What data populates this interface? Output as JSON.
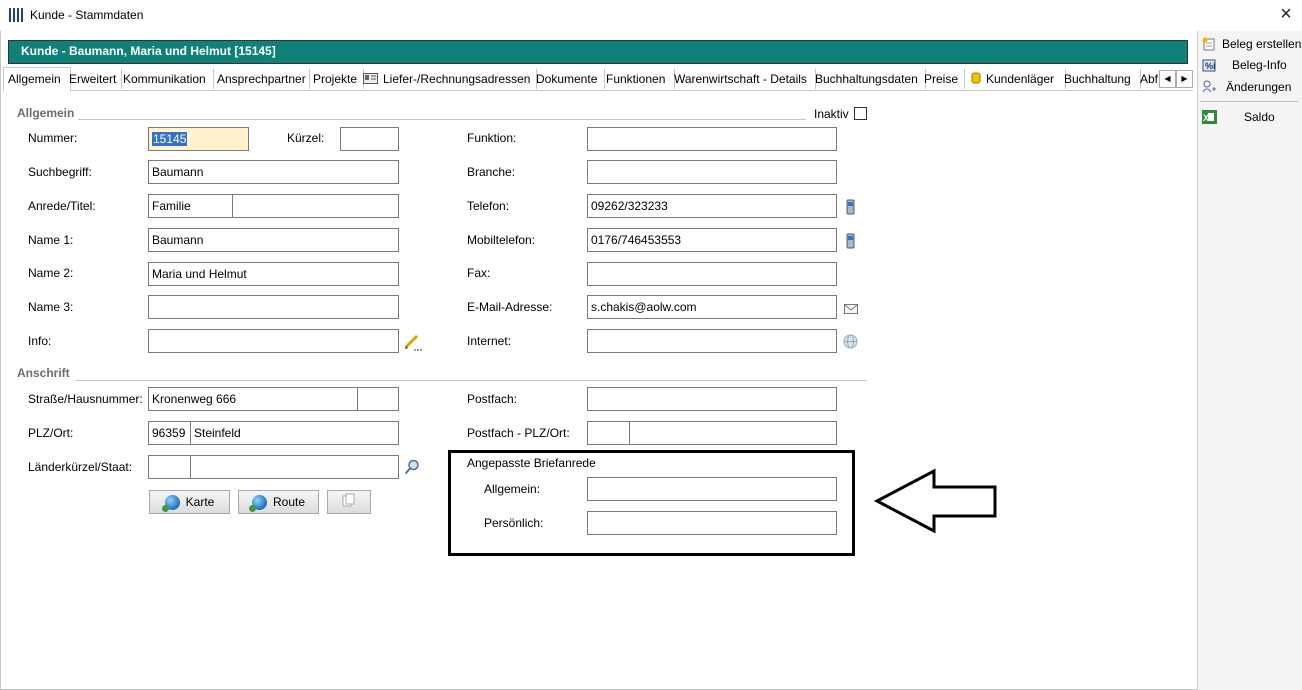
{
  "window": {
    "title": "Kunde - Stammdaten"
  },
  "header": {
    "title": "Kunde  -  Baumann, Maria und Helmut [15145]"
  },
  "tabs": [
    {
      "label": "Allgemein"
    },
    {
      "label": "Erweitert"
    },
    {
      "label": "Kommunikation"
    },
    {
      "label": "Ansprechpartner"
    },
    {
      "label": "Projekte"
    },
    {
      "label": "Liefer-/Rechnungsadressen"
    },
    {
      "label": "Dokumente"
    },
    {
      "label": "Funktionen"
    },
    {
      "label": "Warenwirtschaft - Details"
    },
    {
      "label": "Buchhaltungsdaten"
    },
    {
      "label": "Preise"
    },
    {
      "label": "Kundenläger"
    },
    {
      "label": "Buchhaltung"
    },
    {
      "label": "Abf"
    }
  ],
  "sections": {
    "allgemein": "Allgemein",
    "anschrift": "Anschrift",
    "briefanrede": "Angepasste Briefanrede"
  },
  "inaktiv": {
    "label": "Inaktiv",
    "checked": false
  },
  "fields": {
    "nummer": {
      "label": "Nummer:",
      "value": "15145"
    },
    "kuerzel": {
      "label": "Kürzel:",
      "value": ""
    },
    "suchbegriff": {
      "label": "Suchbegriff:",
      "value": "Baumann"
    },
    "anrede": {
      "label": "Anrede/Titel:",
      "value": "Familie",
      "titel": ""
    },
    "name1": {
      "label": "Name 1:",
      "value": "Baumann"
    },
    "name2": {
      "label": "Name 2:",
      "value": "Maria und Helmut"
    },
    "name3": {
      "label": "Name 3:",
      "value": ""
    },
    "info": {
      "label": "Info:",
      "value": ""
    },
    "funktion": {
      "label": "Funktion:",
      "value": ""
    },
    "branche": {
      "label": "Branche:",
      "value": ""
    },
    "telefon": {
      "label": "Telefon:",
      "value": "09262/323233"
    },
    "mobil": {
      "label": "Mobiltelefon:",
      "value": "0176/746453553"
    },
    "fax": {
      "label": "Fax:",
      "value": ""
    },
    "email": {
      "label": "E-Mail-Adresse:",
      "value": "s.chakis@aolw.com"
    },
    "internet": {
      "label": "Internet:",
      "value": ""
    },
    "strasse": {
      "label": "Straße/Hausnummer:",
      "value": "Kronenweg 666",
      "hausnr": ""
    },
    "plzort": {
      "label": "PLZ/Ort:",
      "plz": "96359",
      "ort": "Steinfeld"
    },
    "land": {
      "label": "Länderkürzel/Staat:",
      "kuerzel": "",
      "staat": ""
    },
    "postfach": {
      "label": "Postfach:",
      "value": ""
    },
    "postfach_plz": {
      "label": "Postfach - PLZ/Ort:",
      "plz": "",
      "ort": ""
    },
    "anrede_allgemein": {
      "label": "Allgemein:",
      "value": ""
    },
    "anrede_persoenlich": {
      "label": "Persönlich:",
      "value": ""
    }
  },
  "buttons": {
    "karte": "Karte",
    "route": "Route"
  },
  "right_panel": {
    "beleg_erstellen": "Beleg erstellen",
    "beleg_info": "Beleg-Info",
    "aenderungen": "Änderungen",
    "saldo": "Saldo"
  },
  "colors": {
    "header": "#0f8179",
    "selection": "#3372c6",
    "highlight_field": "#fff2cc"
  }
}
